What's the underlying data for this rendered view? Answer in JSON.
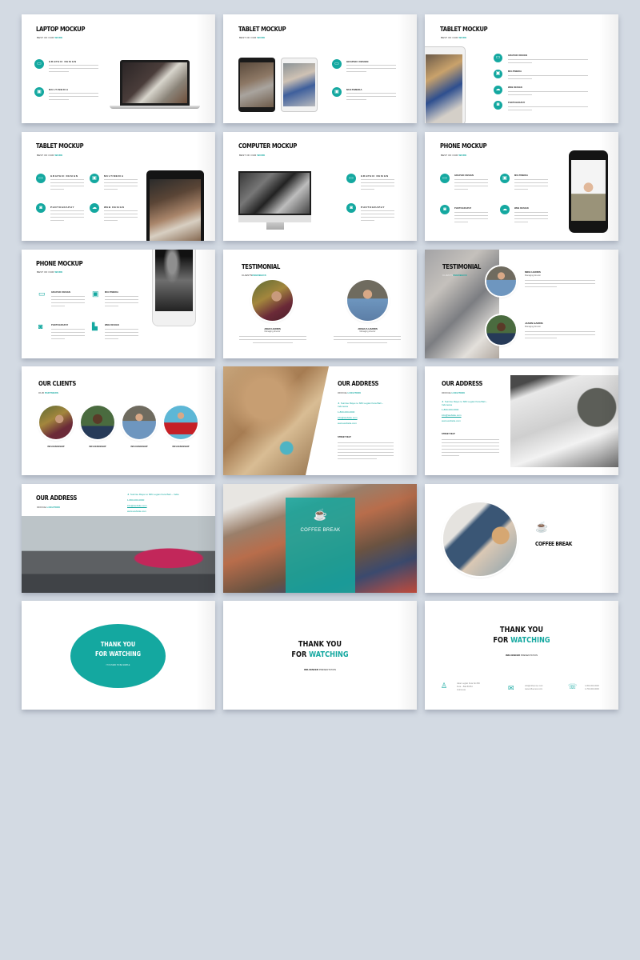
{
  "colors": {
    "accent": "#14a8a0",
    "background": "#d3dae3",
    "slide": "#ffffff",
    "title": "#111111"
  },
  "lorem": "Lorem ipsum dolor sit amet, lacus nulla ac netus nibh aliquet, porttitor ligula justo libero vivamus porttitor diam, convallis morbi.",
  "slides": [
    {
      "title": "LAPTOP MOCKUP",
      "subtitle_prefix": "BEST OF OUR",
      "subtitle_accent": "WORK",
      "features": [
        {
          "icon": "laptop-icon",
          "label": "GRAPHIC DESIGN"
        },
        {
          "icon": "monitor-icon",
          "label": "MULTIMEDIA"
        }
      ]
    },
    {
      "title": "TABLET MOCKUP",
      "subtitle_prefix": "BEST OF OUR",
      "subtitle_accent": "WORK",
      "features": [
        {
          "icon": "laptop-icon",
          "label": "GRAPHIC DESIGN"
        },
        {
          "icon": "monitor-icon",
          "label": "MULTIMEDIA"
        }
      ]
    },
    {
      "title": "TABLET MOCKUP",
      "subtitle_prefix": "BEST OF OUR",
      "subtitle_accent": "WORK",
      "features": [
        {
          "icon": "laptop-icon",
          "label": "GRAPHIC DESIGN"
        },
        {
          "icon": "monitor-icon",
          "label": "MULTIMEDIA"
        },
        {
          "icon": "cloud-icon",
          "label": "WEB DESIGN"
        },
        {
          "icon": "camera-icon",
          "label": "PHOTOGRAPHY"
        }
      ]
    },
    {
      "title": "TABLET MOCKUP",
      "subtitle_prefix": "BEST OF OUR",
      "subtitle_accent": "WORK",
      "features": [
        {
          "icon": "laptop-icon",
          "label": "GRAPHIC DESIGN"
        },
        {
          "icon": "monitor-icon",
          "label": "MULTIMEDIA"
        },
        {
          "icon": "camera-icon",
          "label": "PHOTOGRAPHY"
        },
        {
          "icon": "cloud-icon",
          "label": "WEB DESIGN"
        }
      ]
    },
    {
      "title": "COMPUTER MOCKUP",
      "subtitle_prefix": "BEST OF OUR",
      "subtitle_accent": "WORK",
      "features": [
        {
          "icon": "laptop-icon",
          "label": "GRAPHIC DESIGN"
        },
        {
          "icon": "camera-icon",
          "label": "PHOTOGRAPHY"
        }
      ]
    },
    {
      "title": "PHONE MOCKUP",
      "subtitle_prefix": "BEST OF OUR",
      "subtitle_accent": "WORK",
      "features": [
        {
          "icon": "laptop-icon",
          "label": "GRAPHIC DESIGN"
        },
        {
          "icon": "monitor-icon",
          "label": "MULTIMEDIA"
        },
        {
          "icon": "camera-icon",
          "label": "PHOTOGRAPHY"
        },
        {
          "icon": "cloud-icon",
          "label": "WEB DESIGN"
        }
      ]
    },
    {
      "title": "PHONE MOCKUP",
      "subtitle_prefix": "BEST OF OUR",
      "subtitle_accent": "WORK",
      "features": [
        {
          "icon": "laptop-icon",
          "label": "GRAPHIC DESIGN"
        },
        {
          "icon": "monitor-icon",
          "label": "MULTIMEDIA"
        },
        {
          "icon": "camera-icon",
          "label": "PHOTOGRAPHY"
        },
        {
          "icon": "sitemap-icon",
          "label": "WEB DESIGN"
        }
      ]
    },
    {
      "title": "TESTIMONIAL",
      "subtitle_prefix": "CLIENTS",
      "subtitle_accent": "FEEDBACK",
      "people": [
        {
          "name": "JOHN HARRIS",
          "role": "Managing director"
        },
        {
          "name": "JOSHUA HARRIS",
          "role": "Managing director"
        }
      ]
    },
    {
      "title": "TESTIMONIAL",
      "subtitle_prefix": "CLIENTS",
      "subtitle_accent": "FEEDBACK",
      "people": [
        {
          "name": "MIKE HARRIS",
          "role": "Managing director"
        },
        {
          "name": "JASON HARRIS",
          "role": "Managing director"
        }
      ]
    },
    {
      "title": "OUR CLIENTS",
      "subtitle_prefix": "OUR",
      "subtitle_accent": "PARTNERS",
      "clients": [
        "INFLUENCESHIP",
        "INFLUENCESHIP",
        "INFLUENCESHIP",
        "INFLUENCESHIP"
      ]
    },
    {
      "title": "OUR ADDRESS",
      "subtitle_prefix": "OFFICE",
      "subtitle_accent": "LOCATION",
      "address": "Jl. Sunrise Raya no 666 Legian Kuta Bali – Indonesia",
      "phone": "1-800-000-0000",
      "email": "info@website.com",
      "web": "www.website.com",
      "street_label": "STREET MAP"
    },
    {
      "title": "OUR ADDRESS",
      "subtitle_prefix": "OFFICE",
      "subtitle_accent": "LOCATION",
      "address": "Jl. Sunrise Raya no 666 Legian Kuta Bali – Indonesia",
      "phone": "1-800-000-0000",
      "email": "info@website.com",
      "web": "www.website.com",
      "street_label": "STREET MAP"
    },
    {
      "title": "OUR ADDRESS",
      "subtitle_prefix": "OFFICE",
      "subtitle_accent": "LOCATION",
      "address": "Jl. Sunrise Raya no 666 Legian Kuta Bali – India",
      "phone": "1-800-000-0000",
      "email": "info@website.com",
      "web": "www.website.com"
    },
    {
      "title": "COFFEE BREAK"
    },
    {
      "title": "COFFEE BREAK"
    },
    {
      "line1": "THANK YOU",
      "line2": "FOR WATCHING",
      "tagline": "IT IS HARD TO BE SIMPLE"
    },
    {
      "line1": "THANK YOU",
      "line2_prefix": "FOR",
      "line2_accent": "WATCHING",
      "tagline_bold": "INFLUENCER",
      "tagline_rest": "PRESENTATION"
    },
    {
      "line1": "THANK YOU",
      "line2_prefix": "FOR",
      "line2_accent": "WATCHING",
      "tagline_bold": "INFLUENCER",
      "tagline_rest": "PRESENTATION",
      "contacts": [
        {
          "icon": "user-icon",
          "lines": [
            "Jalan Legian Kuta No.666",
            "Kuta – Bali 80361",
            "Indonesia"
          ]
        },
        {
          "icon": "mail-icon",
          "lines": [
            "info@influencer.com",
            "www.influencer.com"
          ]
        },
        {
          "icon": "phone-icon",
          "lines": [
            "1-800-000-0000",
            "1-700-000-0000"
          ]
        }
      ]
    }
  ]
}
